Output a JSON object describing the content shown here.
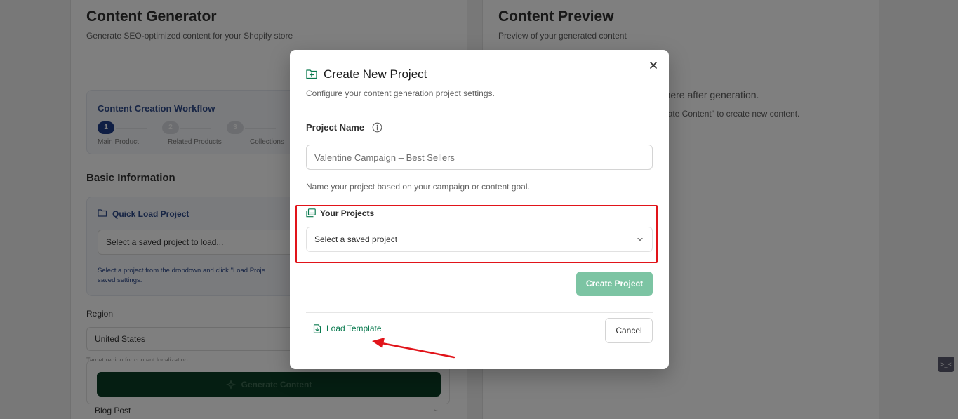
{
  "background": {
    "left_panel": {
      "title": "Content Generator",
      "subtitle": "Generate SEO-optimized content for your Shopify store",
      "workflow": {
        "title": "Content Creation Workflow",
        "steps": [
          {
            "number": "1",
            "label": "Main Product",
            "active": true
          },
          {
            "number": "2",
            "label": "Related Products",
            "active": false
          },
          {
            "number": "3",
            "label": "Collections",
            "active": false
          }
        ]
      },
      "basic_info_title": "Basic Information",
      "quick_load": {
        "title": "Quick Load Project",
        "select_placeholder": "Select a saved project to load...",
        "help_line1": "Select a project from the dropdown and click \"Load Proje",
        "help_line2": "saved settings."
      },
      "region": {
        "label": "Region",
        "value": "United States",
        "help": "Target region for content localization"
      },
      "generate_button": "Generate Content",
      "content_type_value": "Blog Post"
    },
    "right_panel": {
      "title": "Content Preview",
      "subtitle": "Preview of your generated content",
      "empty_line1": "r here after generation.",
      "empty_line2": "erate Content\" to create new content."
    },
    "side_widget_label": ">_<"
  },
  "modal": {
    "title": "Create New Project",
    "subtitle": "Configure your content generation project settings.",
    "project_name_label": "Project Name",
    "project_name_placeholder": "Valentine Campaign – Best Sellers",
    "project_name_help": "Name your project based on your campaign or content goal.",
    "your_projects_label": "Your Projects",
    "your_projects_select": "Select a saved project",
    "create_button": "Create Project",
    "load_template_button": "Load Template",
    "cancel_button": "Cancel"
  },
  "colors": {
    "accent_green": "#0a7a4f",
    "create_button_disabled": "#7cc4a3",
    "annotation_red": "#e1141a",
    "overlay": "rgba(0,0,0,0.5)"
  },
  "icons": {
    "header": "folder-plus-icon",
    "info": "info-icon",
    "projects": "stacked-folders-icon",
    "chevron": "chevron-down-icon",
    "close": "close-icon",
    "load": "file-download-icon"
  }
}
